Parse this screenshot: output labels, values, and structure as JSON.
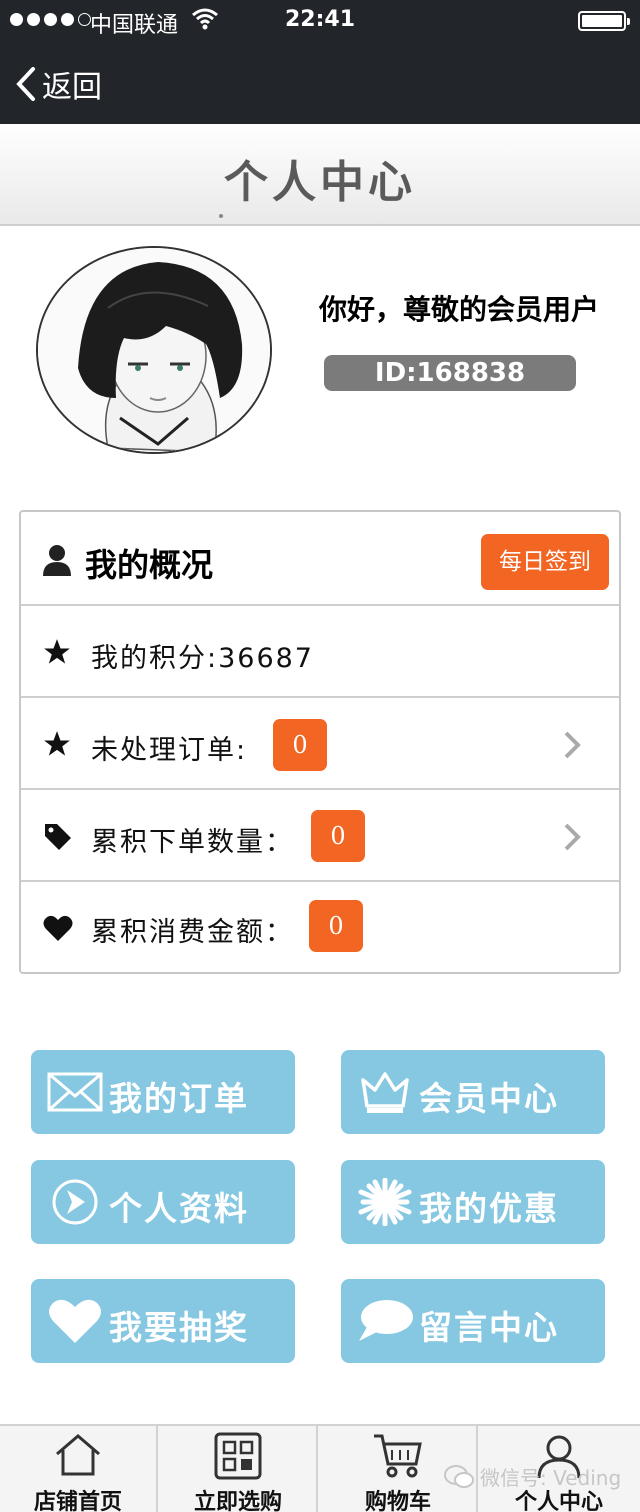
{
  "status_bar": {
    "carrier": "中国联通",
    "time": "22:41"
  },
  "nav": {
    "back_label": "返回"
  },
  "page": {
    "title": "个人中心"
  },
  "profile": {
    "greeting": "你好，尊敬的会员用户",
    "user_id": "ID:168838"
  },
  "overview": {
    "title": "我的概况",
    "checkin_label": "每日签到",
    "rows": [
      {
        "label": "我的积分:36687",
        "icon": "star-icon"
      },
      {
        "label": "未处理订单:",
        "value": "0",
        "icon": "star-icon"
      },
      {
        "label": "累积下单数量：",
        "value": "0",
        "icon": "tag-icon"
      },
      {
        "label": "累积消费金额：",
        "value": "0",
        "icon": "heart-icon"
      }
    ]
  },
  "menu": [
    {
      "label": "我的订单",
      "icon": "envelope-icon"
    },
    {
      "label": "会员中心",
      "icon": "crown-icon"
    },
    {
      "label": "个人资料",
      "icon": "arrow-circle-icon"
    },
    {
      "label": "我的优惠",
      "icon": "asterisk-icon"
    },
    {
      "label": "我要抽奖",
      "icon": "heart-icon"
    },
    {
      "label": "留言中心",
      "icon": "speech-bubble-icon"
    }
  ],
  "tabs": [
    {
      "label": "店铺首页",
      "icon": "home-icon"
    },
    {
      "label": "立即选购",
      "icon": "grid-icon"
    },
    {
      "label": "购物车",
      "icon": "cart-icon"
    },
    {
      "label": "个人中心",
      "icon": "user-icon"
    }
  ],
  "watermark": "微信号: Veding",
  "colors": {
    "accent": "#f26523",
    "menu_button": "#86c7e1",
    "header": "#22262a"
  }
}
